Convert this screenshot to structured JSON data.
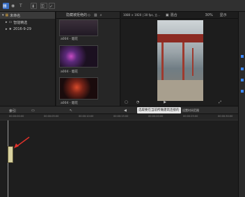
{
  "toolbar": {
    "import_label": "⬇",
    "check_label": "✓",
    "key_label": "⚿"
  },
  "library": {
    "items": [
      {
        "label": "未命名",
        "selected": true
      },
      {
        "label": "智能精选",
        "selected": false
      },
      {
        "label": "2016-9-29",
        "selected": false
      }
    ]
  },
  "browser": {
    "filter_label": "隐藏被拒绝的",
    "clips": [
      {
        "caption": "a004 - 烟花"
      },
      {
        "caption": "a004 - 烟花"
      },
      {
        "caption": "a004 - 烟花"
      }
    ],
    "status": "已选定 1 项 (共 16 项)，10:10"
  },
  "viewer": {
    "format": "1080 × 1920 | 30 fps, 立...",
    "mode_label": "混合",
    "zoom": "30%",
    "display_label": "显示"
  },
  "timeline": {
    "index_label": "索引",
    "tooltip": "选取要在当前所做建筑连接的",
    "right_label": "设置时间范围",
    "ruler_ticks": [
      "00:00:00:00",
      "00:00:05:00",
      "00:00:10:00",
      "00:00:15:00",
      "00:00:20:00",
      "00:00:25:00",
      "00:00:30:00"
    ]
  },
  "colors": {
    "accent": "#3a86ff",
    "clip": "#d9d2a0",
    "arrow": "#e0322b"
  }
}
